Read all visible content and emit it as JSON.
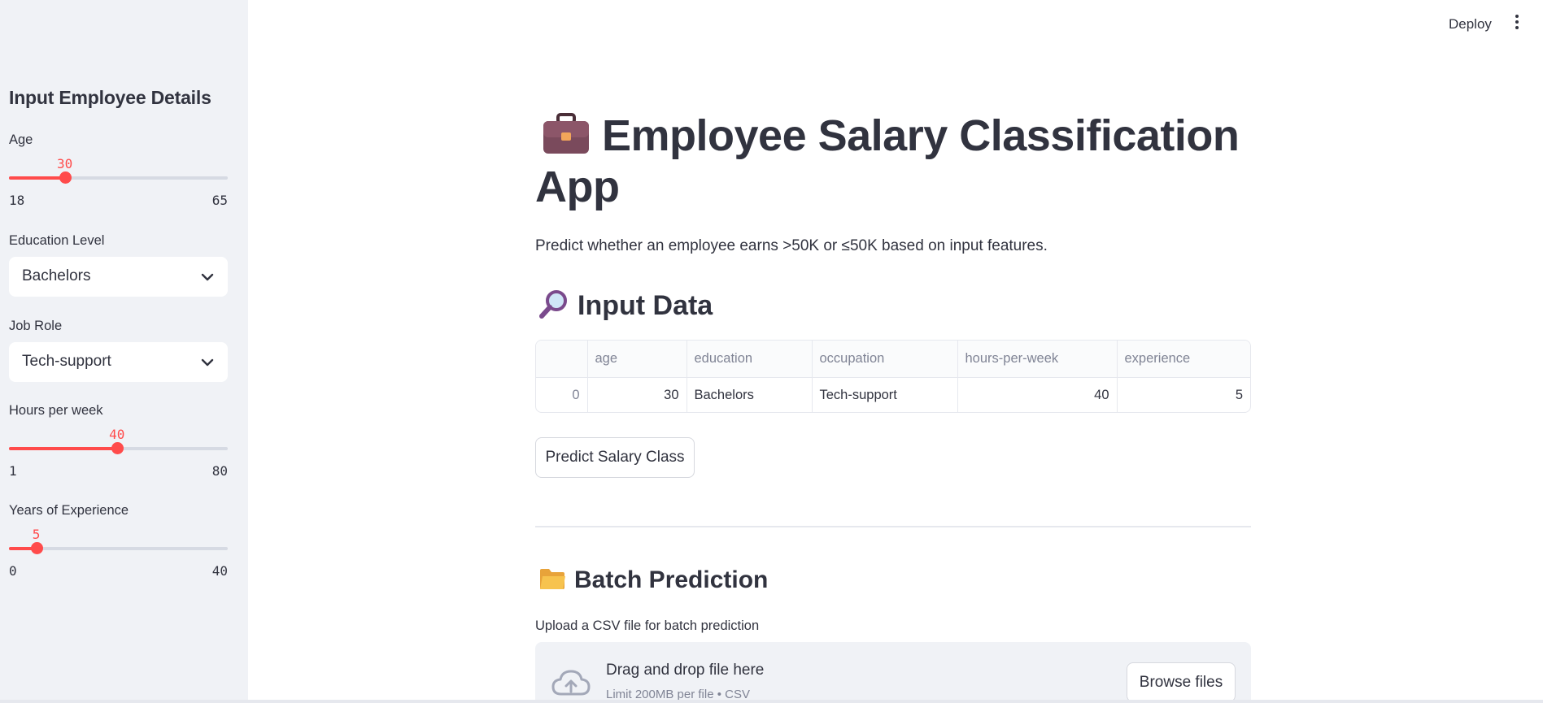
{
  "header": {
    "deploy_label": "Deploy",
    "menu_icon": "kebab-menu-icon"
  },
  "sidebar": {
    "title": "Input Employee Details",
    "age": {
      "label": "Age",
      "value": 30,
      "value_text": "30",
      "min": 18,
      "max": 65,
      "min_text": "18",
      "max_text": "65"
    },
    "education": {
      "label": "Education Level",
      "selected": "Bachelors"
    },
    "job_role": {
      "label": "Job Role",
      "selected": "Tech-support"
    },
    "hours": {
      "label": "Hours per week",
      "value": 40,
      "value_text": "40",
      "min": 1,
      "max": 80,
      "min_text": "1",
      "max_text": "80"
    },
    "experience": {
      "label": "Years of Experience",
      "value": 5,
      "value_text": "5",
      "min": 0,
      "max": 40,
      "min_text": "0",
      "max_text": "40"
    }
  },
  "main": {
    "title": "Employee Salary Classification App",
    "title_icon": "briefcase-icon",
    "subtitle": "Predict whether an employee earns >50K or ≤50K based on input features.",
    "input_section": {
      "heading": "Input Data",
      "icon": "magnifying-glass-icon"
    },
    "table": {
      "columns": [
        "",
        "age",
        "education",
        "occupation",
        "hours-per-week",
        "experience"
      ],
      "rows": [
        {
          "index": "0",
          "age": "30",
          "education": "Bachelors",
          "occupation": "Tech-support",
          "hours": "40",
          "experience": "5"
        }
      ]
    },
    "predict_button": "Predict Salary Class",
    "batch_section": {
      "heading": "Batch Prediction",
      "icon": "folder-icon"
    },
    "upload": {
      "label": "Upload a CSV file for batch prediction",
      "drag_text": "Drag and drop file here",
      "limit_text": "Limit 200MB per file • CSV",
      "browse_button": "Browse files",
      "icon": "cloud-upload-icon"
    }
  },
  "colors": {
    "accent": "#ff4b4b",
    "sidebar_bg": "#f0f2f6",
    "text": "#31333f"
  }
}
